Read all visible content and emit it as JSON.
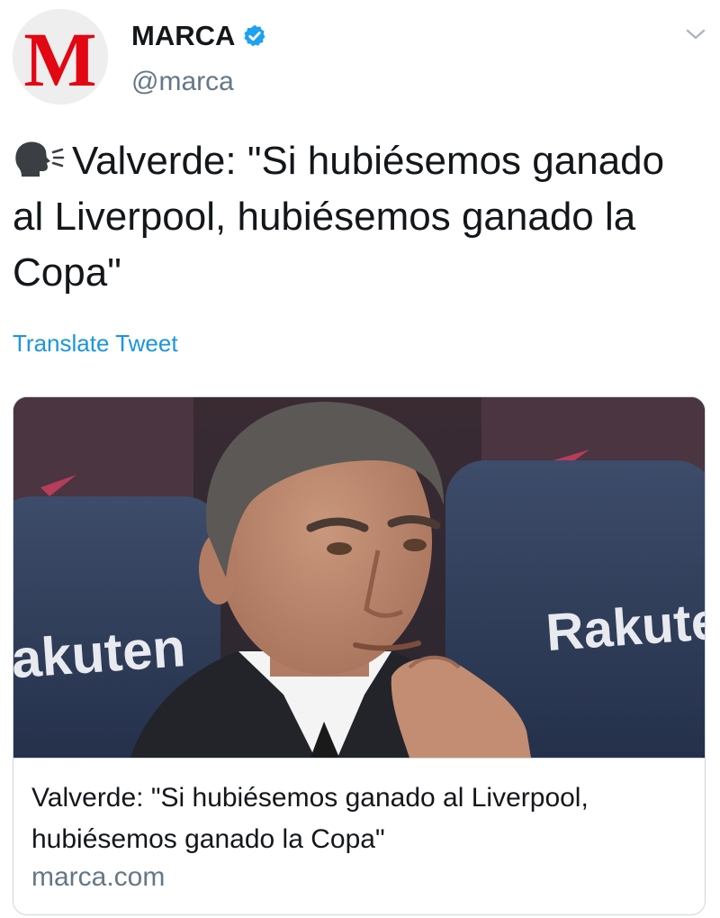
{
  "account": {
    "display_name": "MARCA",
    "handle": "@marca",
    "avatar_letter": "M",
    "verified": true
  },
  "tweet": {
    "emoji_icon": "speaking-head-icon",
    "text": "Valverde: \"Si hubiésemos ganado al Liverpool, hubiésemos ganado la Copa\"",
    "translate_label": "Translate Tweet"
  },
  "card": {
    "title": "Valverde: \"Si hubiésemos ganado al Liverpool, hubiésemos ganado la Copa\"",
    "domain": "marca.com",
    "image_brand_left": "akuten",
    "image_brand_right": "Rakute"
  },
  "colors": {
    "brand_red": "#e30613",
    "link_blue": "#1b95e0",
    "verified_blue": "#1da1f2",
    "secondary_text": "#657786",
    "border": "#ccd6dd"
  }
}
